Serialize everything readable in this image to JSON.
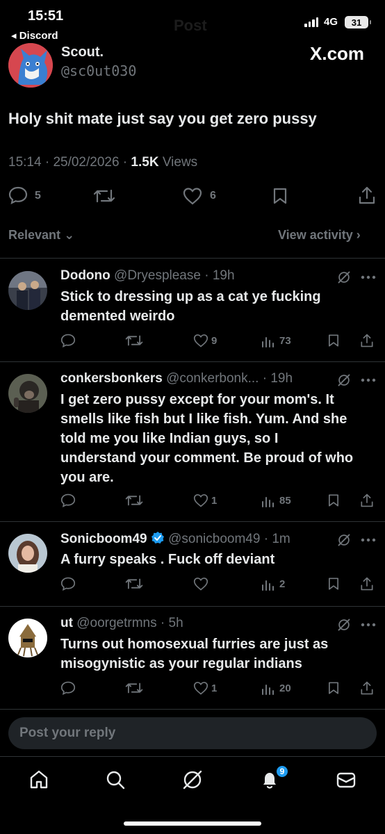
{
  "status": {
    "time": "15:51",
    "back": "◂ Discord",
    "network": "4G",
    "battery": "31"
  },
  "header": {
    "ghost_title": "Post"
  },
  "post": {
    "name": "Scout.",
    "handle": "@sc0ut030",
    "source": "X.com",
    "text": "Holy shit mate just say you get zero pussy",
    "time": "15:14",
    "date": "25/02/2026",
    "views_count": "1.5K",
    "views_label": "Views",
    "replies": "5",
    "likes": "6"
  },
  "sort": {
    "label": "Relevant",
    "view_activity": "View activity"
  },
  "replies": [
    {
      "name": "Dodono",
      "handle": "@Dryesplease",
      "age": "19h",
      "lines": [
        "Stick to dressing up as a cat ye fucking",
        "demented weirdo"
      ],
      "likes": "9",
      "views": "73"
    },
    {
      "name": "conkersbonkers",
      "handle": "@conkerbonk...",
      "age": "19h",
      "lines": [
        "I get zero pussy except for your mom's. It",
        "smells like fish but I like fish. Yum. And she",
        "told me you like Indian guys, so I",
        "understand your comment. Be proud of who",
        "you are."
      ],
      "likes": "1",
      "views": "85"
    },
    {
      "name": "Sonicboom49",
      "handle": "@sonicboom49",
      "age": "1m",
      "lines": [
        "A furry speaks . Fuck off deviant"
      ],
      "likes": "",
      "views": "2"
    },
    {
      "name": "ut",
      "handle": "@oorgetrmns",
      "age": "5h",
      "lines": [
        "Turns out homosexual furries are just as",
        "misogynistic as your regular indians"
      ],
      "likes": "1",
      "views": "20"
    }
  ],
  "reply_box": {
    "placeholder": "Post your reply"
  },
  "tabbar": {
    "notification_count": "9"
  },
  "colors": {
    "background": "#000000",
    "muted": "#71767b",
    "text": "#e7e9ea",
    "accent": "#1d9bf0"
  }
}
